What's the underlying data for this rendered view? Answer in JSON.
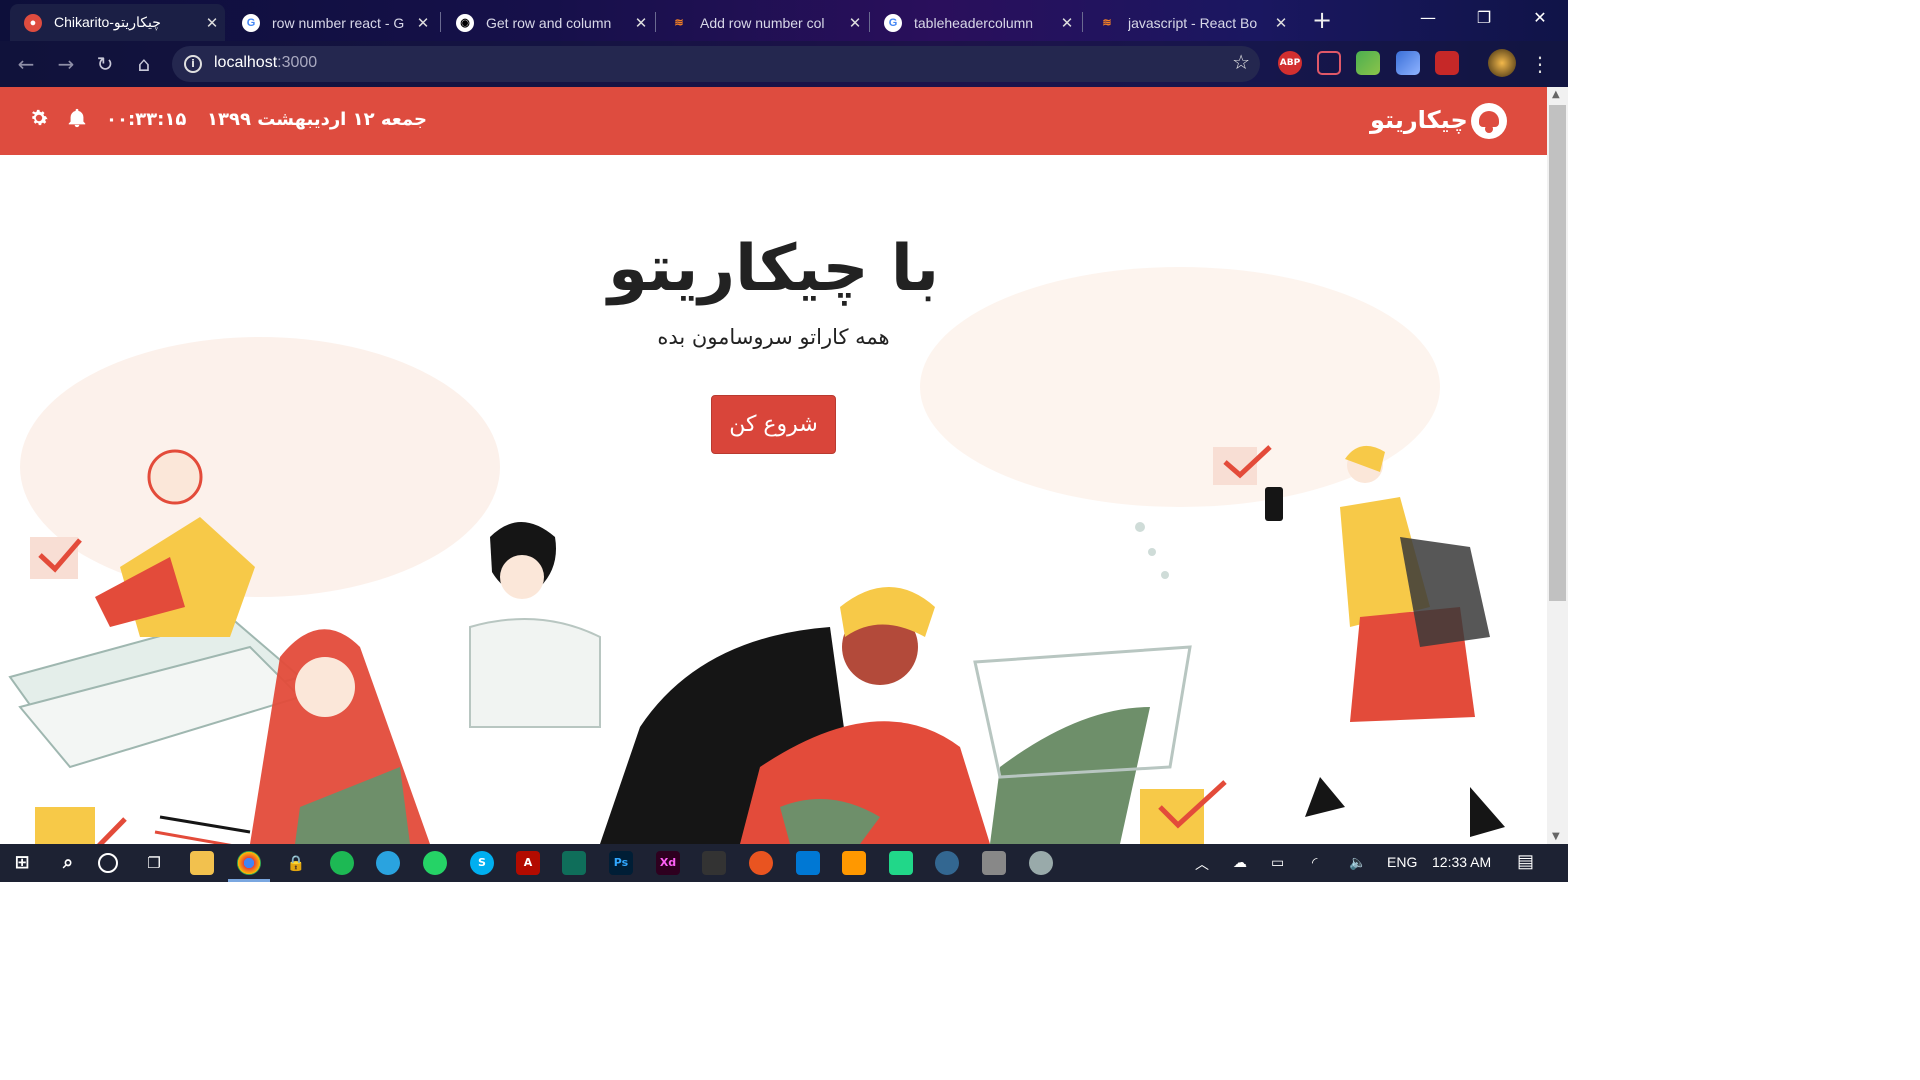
{
  "browser": {
    "tabs": [
      {
        "title": "Chikarito-چیکاریتو",
        "favicon": "chikarito-logo-icon",
        "active": true
      },
      {
        "title": "row number react - G",
        "favicon": "google-icon",
        "active": false
      },
      {
        "title": "Get row and column",
        "favicon": "github-icon",
        "active": false
      },
      {
        "title": "Add row number col",
        "favicon": "stackoverflow-icon",
        "active": false
      },
      {
        "title": "tableheadercolumn",
        "favicon": "google-icon",
        "active": false
      },
      {
        "title": "javascript - React Bo",
        "favicon": "stackoverflow-icon",
        "active": false
      }
    ],
    "url_host": "localhost",
    "url_port": ":3000",
    "extensions": [
      "ABP"
    ]
  },
  "appbar": {
    "brand": "چیکاریتو",
    "date": "جمعه ۱۲ اردیبهشت ۱۳۹۹",
    "clock": "۰۰:۳۳:۱۵"
  },
  "hero": {
    "title": "با چیکاریتو",
    "subtitle": "همه کاراتو سروسامون بده",
    "cta": "شروع کن"
  },
  "taskbar": {
    "language": "ENG",
    "time": "12:33 AM",
    "apps": [
      "Ps",
      "Xd"
    ]
  },
  "colors": {
    "brand_red": "#de4c3f",
    "cta_red": "#d9453a"
  }
}
